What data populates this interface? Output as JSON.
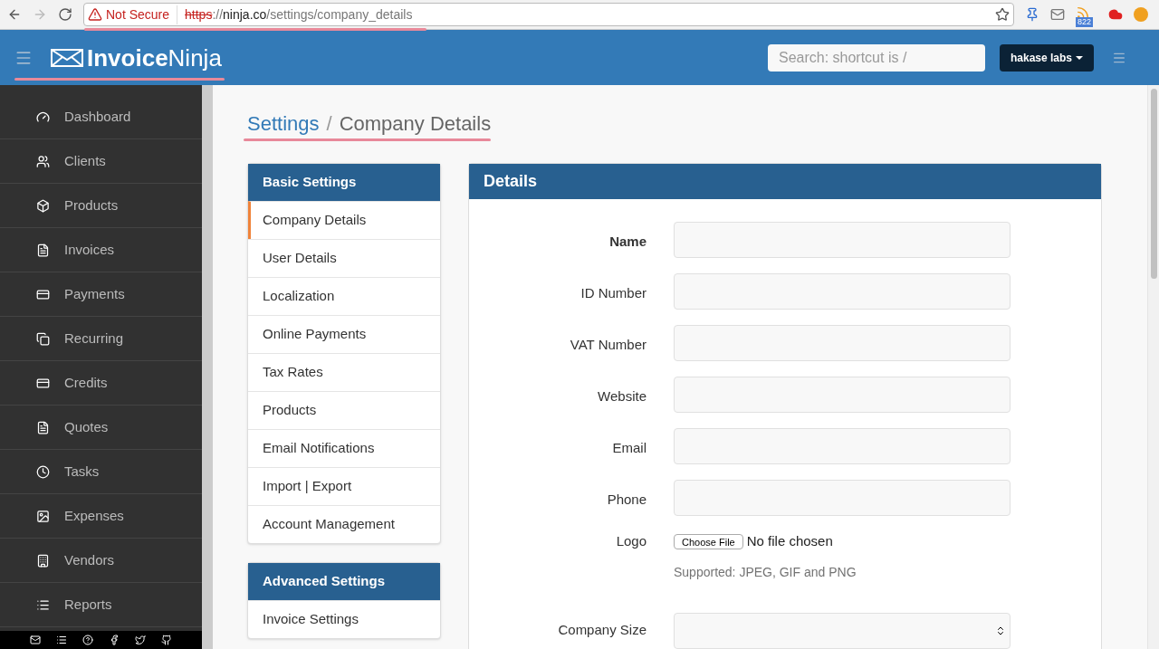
{
  "browser": {
    "security": "Not Secure",
    "url": [
      {
        "kind": "scheme",
        "text": "https"
      },
      {
        "kind": "dim",
        "text": "://"
      },
      {
        "kind": "host",
        "text": "ninja.co"
      },
      {
        "kind": "dim",
        "text": "/settings/company_details"
      }
    ],
    "badge": "822"
  },
  "topbar": {
    "logo_bold": "Invoice",
    "logo_light": "Ninja",
    "search": {
      "placeholder": "Search: shortcut is /"
    },
    "account": "hakase labs"
  },
  "sidebar": {
    "items": [
      {
        "label": "Dashboard"
      },
      {
        "label": "Clients"
      },
      {
        "label": "Products"
      },
      {
        "label": "Invoices"
      },
      {
        "label": "Payments"
      },
      {
        "label": "Recurring"
      },
      {
        "label": "Credits"
      },
      {
        "label": "Quotes"
      },
      {
        "label": "Tasks"
      },
      {
        "label": "Expenses"
      },
      {
        "label": "Vendors"
      },
      {
        "label": "Reports"
      }
    ]
  },
  "breadcrumb": {
    "parent": "Settings",
    "separator": "/",
    "current": "Company Details"
  },
  "settings_nav": [
    {
      "title": "Basic Settings",
      "items": [
        {
          "label": "Company Details",
          "selected": true
        },
        {
          "label": "User Details",
          "selected": false
        },
        {
          "label": "Localization",
          "selected": false
        },
        {
          "label": "Online Payments",
          "selected": false
        },
        {
          "label": "Tax Rates",
          "selected": false
        },
        {
          "label": "Products",
          "selected": false
        },
        {
          "label": "Email Notifications",
          "selected": false
        },
        {
          "label": "Import | Export",
          "selected": false
        },
        {
          "label": "Account Management",
          "selected": false
        }
      ]
    },
    {
      "title": "Advanced Settings",
      "items": [
        {
          "label": "Invoice Settings",
          "selected": false
        }
      ]
    }
  ],
  "details": {
    "title": "Details",
    "fields": [
      {
        "kind": "text",
        "label": "Name",
        "required": true
      },
      {
        "kind": "text",
        "label": "ID Number",
        "required": false
      },
      {
        "kind": "text",
        "label": "VAT Number",
        "required": false
      },
      {
        "kind": "text",
        "label": "Website",
        "required": false
      },
      {
        "kind": "text",
        "label": "Email",
        "required": false
      },
      {
        "kind": "text",
        "label": "Phone",
        "required": false
      },
      {
        "kind": "file",
        "label": "Logo",
        "required": false,
        "button": "Choose File",
        "status": "No file chosen",
        "help": "Supported: JPEG, GIF and PNG"
      },
      {
        "kind": "select",
        "label": "Company Size",
        "required": false
      }
    ]
  }
}
